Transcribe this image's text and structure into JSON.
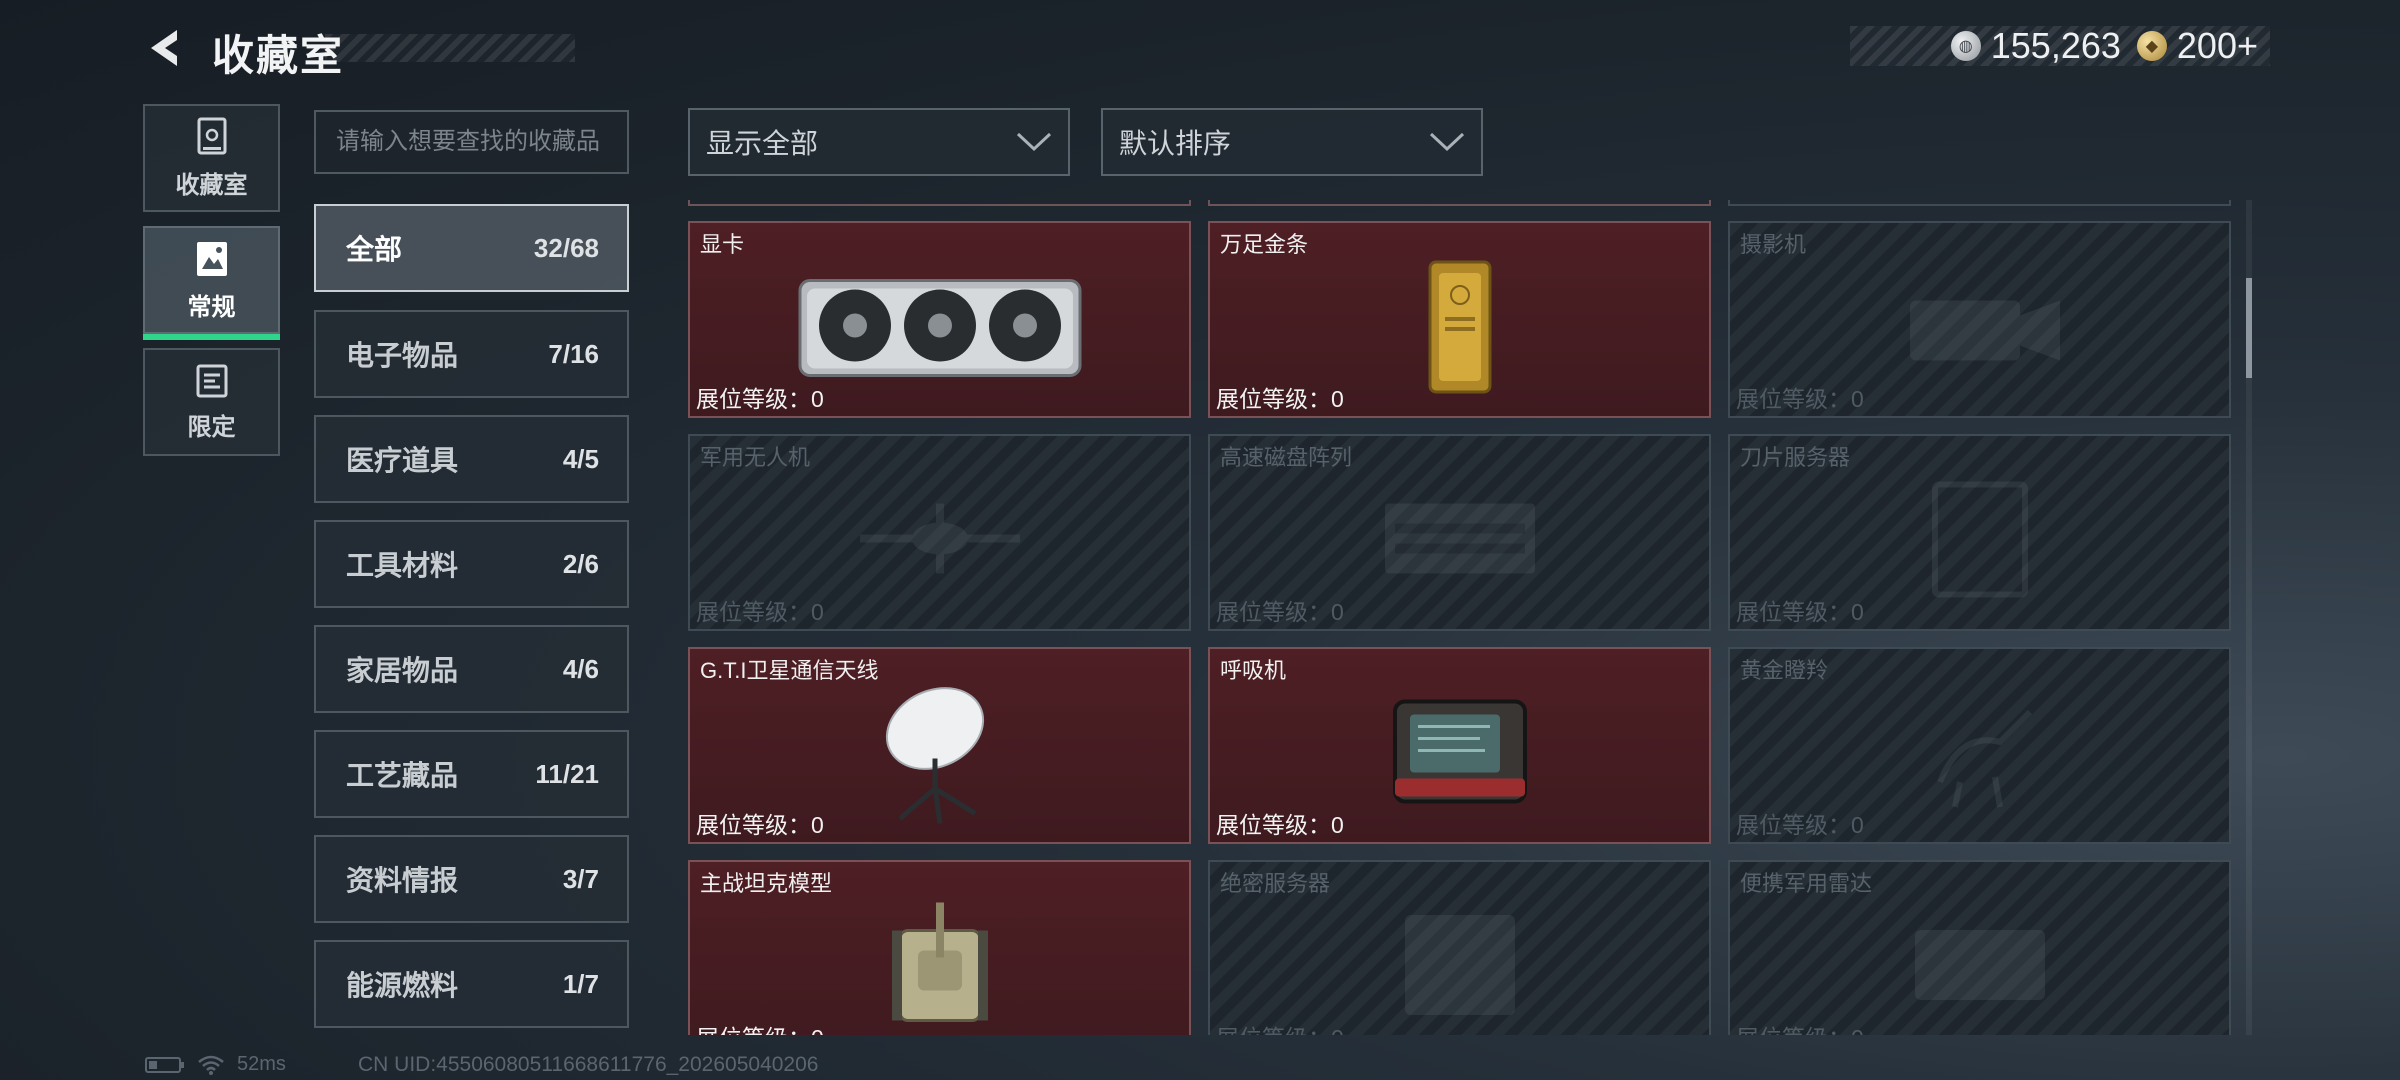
{
  "header": {
    "title": "收藏室",
    "currencies": [
      {
        "icon": "silver-coin-icon",
        "value": "155,263"
      },
      {
        "icon": "gold-coin-icon",
        "value": "200+"
      }
    ]
  },
  "rail": [
    {
      "label": "收藏室",
      "icon": "cabinet-icon",
      "active": false
    },
    {
      "label": "常规",
      "icon": "picture-icon",
      "active": true
    },
    {
      "label": "限定",
      "icon": "limited-icon",
      "active": false
    }
  ],
  "search": {
    "placeholder": "请输入想要查找的收藏品"
  },
  "categories": [
    {
      "label": "全部",
      "count": "32/68",
      "active": true
    },
    {
      "label": "电子物品",
      "count": "7/16"
    },
    {
      "label": "医疗道具",
      "count": "4/5"
    },
    {
      "label": "工具材料",
      "count": "2/6"
    },
    {
      "label": "家居物品",
      "count": "4/6"
    },
    {
      "label": "工艺藏品",
      "count": "11/21"
    },
    {
      "label": "资料情报",
      "count": "3/7"
    },
    {
      "label": "能源燃料",
      "count": "1/7"
    }
  ],
  "filters": {
    "display": "显示全部",
    "sort": "默认排序"
  },
  "level_label": "展位等级：0",
  "items": [
    {
      "name": "显卡",
      "owned": true,
      "icon": "gpu-icon"
    },
    {
      "name": "万足金条",
      "owned": true,
      "icon": "gold-bar-icon"
    },
    {
      "name": "摄影机",
      "owned": false,
      "icon": "camera-icon"
    },
    {
      "name": "军用无人机",
      "owned": false,
      "icon": "drone-icon"
    },
    {
      "name": "高速磁盘阵列",
      "owned": false,
      "icon": "disk-array-icon"
    },
    {
      "name": "刀片服务器",
      "owned": false,
      "icon": "blade-server-icon"
    },
    {
      "name": "G.T.I卫星通信天线",
      "owned": true,
      "icon": "satellite-dish-icon"
    },
    {
      "name": "呼吸机",
      "owned": true,
      "icon": "ventilator-icon"
    },
    {
      "name": "黄金瞪羚",
      "owned": false,
      "icon": "gazelle-icon"
    },
    {
      "name": "主战坦克模型",
      "owned": true,
      "icon": "tank-icon"
    },
    {
      "name": "绝密服务器",
      "owned": false,
      "icon": "server-icon"
    },
    {
      "name": "便携军用雷达",
      "owned": false,
      "icon": "radar-icon"
    }
  ],
  "status": {
    "ping": "52ms",
    "uid": "CN UID:45506080511668611776_202605040206"
  },
  "colors": {
    "owned_card": "#4e1f24",
    "active_rail_underline": "#2fd58a"
  }
}
